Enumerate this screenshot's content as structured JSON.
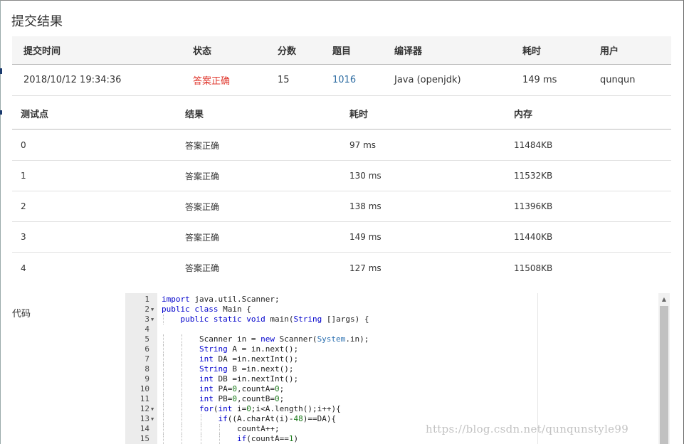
{
  "page": {
    "title": "提交结果"
  },
  "submission": {
    "headers": {
      "time": "提交时间",
      "status": "状态",
      "score": "分数",
      "problem": "题目",
      "compiler": "编译器",
      "duration": "耗时",
      "user": "用户"
    },
    "row": {
      "time": "2018/10/12 19:34:36",
      "status": "答案正确",
      "score": "15",
      "problem": "1016",
      "compiler": "Java (openjdk)",
      "duration": "149 ms",
      "user": "qunqun"
    }
  },
  "tests": {
    "headers": {
      "case": "测试点",
      "result": "结果",
      "duration": "耗时",
      "memory": "内存"
    },
    "rows": [
      {
        "case": "0",
        "result": "答案正确",
        "duration": "97 ms",
        "memory": "11484KB"
      },
      {
        "case": "1",
        "result": "答案正确",
        "duration": "130 ms",
        "memory": "11532KB"
      },
      {
        "case": "2",
        "result": "答案正确",
        "duration": "138 ms",
        "memory": "11396KB"
      },
      {
        "case": "3",
        "result": "答案正确",
        "duration": "149 ms",
        "memory": "11440KB"
      },
      {
        "case": "4",
        "result": "答案正确",
        "duration": "127 ms",
        "memory": "11508KB"
      }
    ]
  },
  "code": {
    "label": "代码",
    "lines": [
      {
        "n": "1",
        "fold": "",
        "text": "import java.util.Scanner;"
      },
      {
        "n": "2",
        "fold": "▼",
        "text": "public class Main {"
      },
      {
        "n": "3",
        "fold": "▼",
        "text": "    public static void main(String []args) {"
      },
      {
        "n": "4",
        "fold": "",
        "text": ""
      },
      {
        "n": "5",
        "fold": "",
        "text": "        Scanner in = new Scanner(System.in);"
      },
      {
        "n": "6",
        "fold": "",
        "text": "        String A = in.next();"
      },
      {
        "n": "7",
        "fold": "",
        "text": "        int DA =in.nextInt();"
      },
      {
        "n": "8",
        "fold": "",
        "text": "        String B =in.next();"
      },
      {
        "n": "9",
        "fold": "",
        "text": "        int DB =in.nextInt();"
      },
      {
        "n": "10",
        "fold": "",
        "text": "        int PA=0,countA=0;"
      },
      {
        "n": "11",
        "fold": "",
        "text": "        int PB=0,countB=0;"
      },
      {
        "n": "12",
        "fold": "▼",
        "text": "        for(int i=0;i<A.length();i++){"
      },
      {
        "n": "13",
        "fold": "▼",
        "text": "            if((A.charAt(i)-48)==DA){"
      },
      {
        "n": "14",
        "fold": "",
        "text": "                countA++;"
      },
      {
        "n": "15",
        "fold": "",
        "text": "                if(countA==1)"
      }
    ]
  },
  "watermark": "https://blog.csdn.net/qunqunstyle99",
  "colors": {
    "accepted": "#e0392f",
    "link": "#2d6ca2",
    "header_bg": "#f5f5f5"
  }
}
